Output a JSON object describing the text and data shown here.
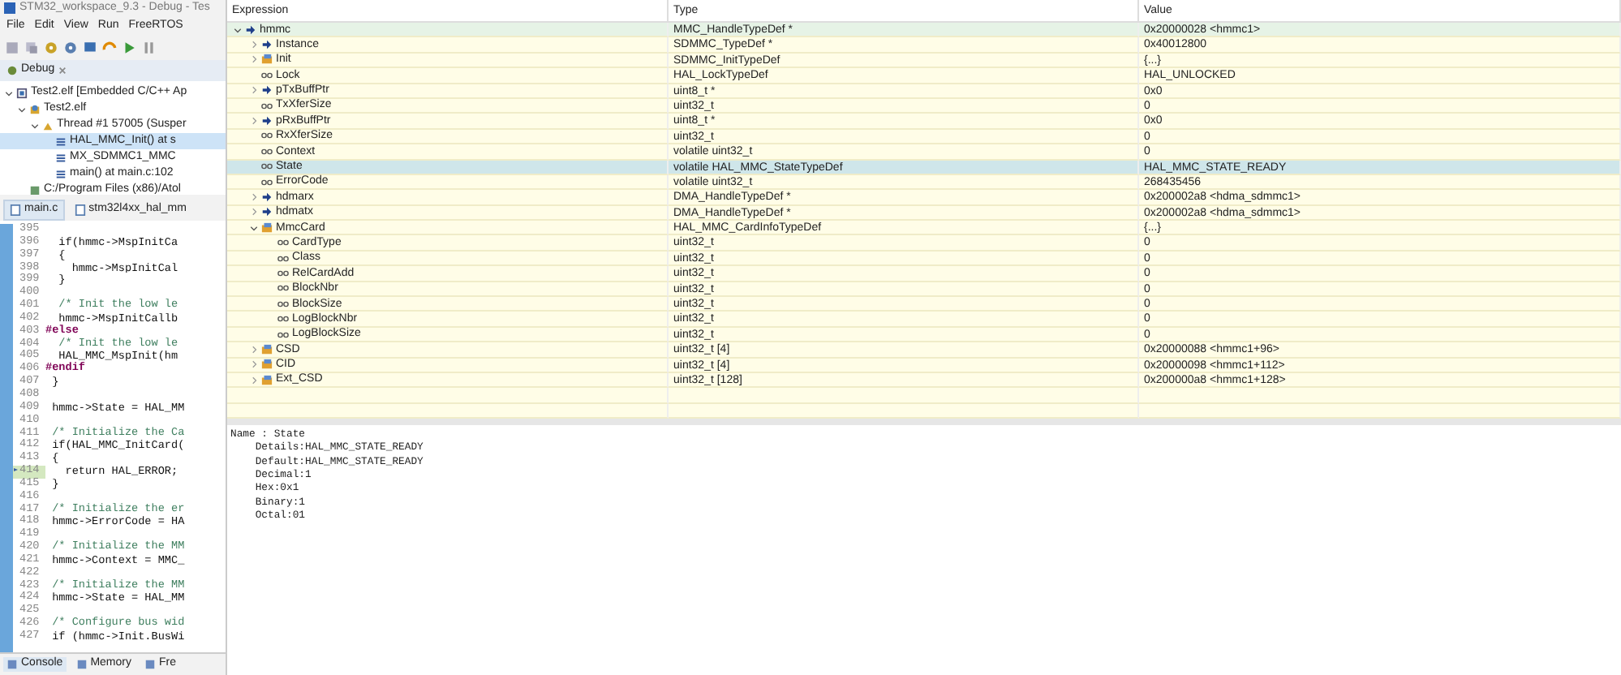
{
  "window": {
    "title": "STM32_workspace_9.3 - Debug - Tes"
  },
  "menu": [
    "File",
    "Edit",
    "View",
    "Run",
    "FreeRTOS"
  ],
  "debug_view": {
    "tab": "Debug",
    "tree": [
      {
        "label": "Test2.elf [Embedded C/C++ Ap",
        "kind": "launch",
        "expanded": true,
        "selected": false,
        "children": [
          {
            "label": "Test2.elf",
            "kind": "process",
            "expanded": true,
            "selected": false,
            "children": [
              {
                "label": "Thread #1 57005 (Susper",
                "kind": "thread",
                "expanded": true,
                "selected": false,
                "children": [
                  {
                    "label": "HAL_MMC_Init() at s",
                    "kind": "frame",
                    "selected": true
                  },
                  {
                    "label": "MX_SDMMC1_MMC",
                    "kind": "frame",
                    "selected": false
                  },
                  {
                    "label": "main() at main.c:102",
                    "kind": "frame",
                    "selected": false
                  }
                ]
              }
            ]
          },
          {
            "label": "C:/Program Files (x86)/Atol",
            "kind": "path",
            "selected": false
          }
        ]
      }
    ]
  },
  "editor_tabs": [
    {
      "label": "main.c",
      "selected": true
    },
    {
      "label": "stm32l4xx_hal_mm",
      "selected": false
    }
  ],
  "code": [
    {
      "number": "395",
      "current": false
    },
    {
      "number": "396",
      "text": "  if(hmmc->MspInitCa",
      "kind": "code",
      "current": false
    },
    {
      "number": "397",
      "text": "  {",
      "kind": "code",
      "current": false
    },
    {
      "number": "398",
      "text": "    hmmc->MspInitCal",
      "kind": "code",
      "current": false
    },
    {
      "number": "399",
      "text": "  }",
      "kind": "code",
      "current": false
    },
    {
      "number": "400",
      "current": false
    },
    {
      "number": "401",
      "text": "  /* Init the low le",
      "kind": "comment",
      "current": false
    },
    {
      "number": "402",
      "text": "  hmmc->MspInitCallb",
      "kind": "code",
      "current": false
    },
    {
      "number": "403",
      "text": "#else",
      "kind": "directive",
      "current": false
    },
    {
      "number": "404",
      "text": "  /* Init the low le",
      "kind": "comment",
      "current": false
    },
    {
      "number": "405",
      "text": "  HAL_MMC_MspInit(hm",
      "kind": "code",
      "current": false
    },
    {
      "number": "406",
      "text": "#endif",
      "kind": "directive",
      "current": false
    },
    {
      "number": "407",
      "text": " }",
      "kind": "code",
      "current": false
    },
    {
      "number": "408",
      "current": false
    },
    {
      "number": "409",
      "text": " hmmc->State = HAL_MM",
      "kind": "code",
      "current": false
    },
    {
      "number": "410",
      "current": false
    },
    {
      "number": "411",
      "text": " /* Initialize the Ca",
      "kind": "comment",
      "current": false
    },
    {
      "number": "412",
      "text": " if(HAL_MMC_InitCard(",
      "kind": "code",
      "current": false
    },
    {
      "number": "413",
      "text": " {",
      "kind": "code",
      "current": false
    },
    {
      "number": "414",
      "text": "   return HAL_ERROR;",
      "kind": "code",
      "current": true
    },
    {
      "number": "415",
      "text": " }",
      "kind": "code",
      "current": false
    },
    {
      "number": "416",
      "current": false
    },
    {
      "number": "417",
      "text": " /* Initialize the er",
      "kind": "comment",
      "current": false
    },
    {
      "number": "418",
      "text": " hmmc->ErrorCode = HA",
      "kind": "code",
      "current": false
    },
    {
      "number": "419",
      "current": false
    },
    {
      "number": "420",
      "text": " /* Initialize the MM",
      "kind": "comment",
      "current": false
    },
    {
      "number": "421",
      "text": " hmmc->Context = MMC_",
      "kind": "code",
      "current": false
    },
    {
      "number": "422",
      "current": false
    },
    {
      "number": "423",
      "text": " /* Initialize the MM",
      "kind": "comment",
      "current": false
    },
    {
      "number": "424",
      "text": " hmmc->State = HAL_MM",
      "kind": "code",
      "current": false
    },
    {
      "number": "425",
      "current": false
    },
    {
      "number": "426",
      "text": " /* Configure bus wid",
      "kind": "comment",
      "current": false
    },
    {
      "number": "427",
      "text": " if (hmmc->Init.BusWi",
      "kind": "code",
      "current": false
    }
  ],
  "bottom_tabs": [
    {
      "label": "Console",
      "selected": true
    },
    {
      "label": "Memory",
      "selected": false
    },
    {
      "label": "Fre",
      "selected": false
    }
  ],
  "expressions": {
    "columns": [
      "Expression",
      "Type",
      "Value"
    ],
    "rows": [
      {
        "name": "hmmc",
        "kind": "pointer",
        "type": "MMC_HandleTypeDef *",
        "value": "0x20000028 <hmmc1>",
        "expanded": true,
        "selected": false,
        "children": [
          {
            "name": "Instance",
            "kind": "pointer",
            "type": "SDMMC_TypeDef *",
            "value": "0x40012800",
            "expanded": false,
            "selected": false
          },
          {
            "name": "Init",
            "kind": "struct",
            "type": "SDMMC_InitTypeDef",
            "value": "{...}",
            "expanded": false,
            "selected": false
          },
          {
            "name": "Lock",
            "kind": "field",
            "type": "HAL_LockTypeDef",
            "value": "HAL_UNLOCKED",
            "selected": false
          },
          {
            "name": "pTxBuffPtr",
            "kind": "pointer",
            "type": "uint8_t *",
            "value": "0x0",
            "expanded": false,
            "selected": false
          },
          {
            "name": "TxXferSize",
            "kind": "field",
            "type": "uint32_t",
            "value": "0",
            "selected": false
          },
          {
            "name": "pRxBuffPtr",
            "kind": "pointer",
            "type": "uint8_t *",
            "value": "0x0",
            "expanded": false,
            "selected": false
          },
          {
            "name": "RxXferSize",
            "kind": "field",
            "type": "uint32_t",
            "value": "0",
            "selected": false
          },
          {
            "name": "Context",
            "kind": "field",
            "type": "volatile uint32_t",
            "value": "0",
            "selected": false
          },
          {
            "name": "State",
            "kind": "field",
            "type": "volatile HAL_MMC_StateTypeDef",
            "value": "HAL_MMC_STATE_READY",
            "selected": true
          },
          {
            "name": "ErrorCode",
            "kind": "field",
            "type": "volatile uint32_t",
            "value": "268435456",
            "selected": false
          },
          {
            "name": "hdmarx",
            "kind": "pointer",
            "type": "DMA_HandleTypeDef *",
            "value": "0x200002a8 <hdma_sdmmc1>",
            "expanded": false,
            "selected": false
          },
          {
            "name": "hdmatx",
            "kind": "pointer",
            "type": "DMA_HandleTypeDef *",
            "value": "0x200002a8 <hdma_sdmmc1>",
            "expanded": false,
            "selected": false
          },
          {
            "name": "MmcCard",
            "kind": "struct",
            "type": "HAL_MMC_CardInfoTypeDef",
            "value": "{...}",
            "expanded": true,
            "selected": false,
            "children": [
              {
                "name": "CardType",
                "kind": "field",
                "type": "uint32_t",
                "value": "0",
                "selected": false
              },
              {
                "name": "Class",
                "kind": "field",
                "type": "uint32_t",
                "value": "0",
                "selected": false
              },
              {
                "name": "RelCardAdd",
                "kind": "field",
                "type": "uint32_t",
                "value": "0",
                "selected": false
              },
              {
                "name": "BlockNbr",
                "kind": "field",
                "type": "uint32_t",
                "value": "0",
                "selected": false
              },
              {
                "name": "BlockSize",
                "kind": "field",
                "type": "uint32_t",
                "value": "0",
                "selected": false
              },
              {
                "name": "LogBlockNbr",
                "kind": "field",
                "type": "uint32_t",
                "value": "0",
                "selected": false
              },
              {
                "name": "LogBlockSize",
                "kind": "field",
                "type": "uint32_t",
                "value": "0",
                "selected": false
              }
            ]
          },
          {
            "name": "CSD",
            "kind": "struct",
            "type": "uint32_t [4]",
            "value": "0x20000088 <hmmc1+96>",
            "expanded": false,
            "selected": false
          },
          {
            "name": "CID",
            "kind": "struct",
            "type": "uint32_t [4]",
            "value": "0x20000098 <hmmc1+112>",
            "expanded": false,
            "selected": false
          },
          {
            "name": "Ext_CSD",
            "kind": "struct",
            "type": "uint32_t [128]",
            "value": "0x200000a8 <hmmc1+128>",
            "expanded": false,
            "selected": false
          }
        ]
      }
    ]
  },
  "details": [
    "Name : State",
    "    Details:HAL_MMC_STATE_READY",
    "    Default:HAL_MMC_STATE_READY",
    "    Decimal:1",
    "    Hex:0x1",
    "    Binary:1",
    "    Octal:01"
  ]
}
